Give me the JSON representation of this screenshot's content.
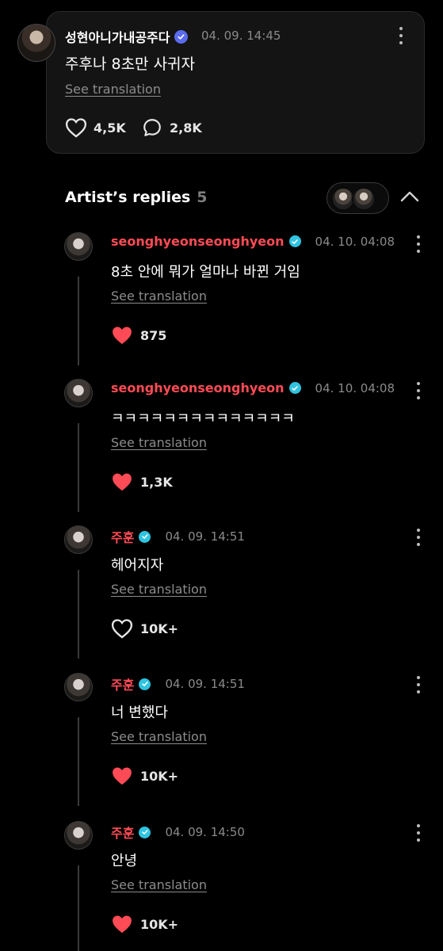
{
  "post": {
    "author": "성현아니가내공주다",
    "time": "04. 09. 14:45",
    "text": "주후나 8초만 사귀자",
    "see_translation": "See translation",
    "likes": "4,5K",
    "comments": "2,8K",
    "verify_icon": "verified-badge-icon",
    "accent": "#5b6cf0"
  },
  "replies_section": {
    "title": "Artist’s replies",
    "count": "5"
  },
  "replies": [
    {
      "name": "seonghyeonseonghyeon",
      "time": "04. 10. 04:08",
      "text": "8초 안에 뭐가 얼마나 바뀐 거임",
      "see_translation": "See translation",
      "likes": "875",
      "liked": true
    },
    {
      "name": "seonghyeonseonghyeon",
      "time": "04. 10. 04:08",
      "text": "ㅋㅋㅋㅋㅋㅋㅋㅋㅋㅋㅋㅋㅋㅋ",
      "see_translation": "See translation",
      "likes": "1,3K",
      "liked": true
    },
    {
      "name": "주훈",
      "time": "04. 09. 14:51",
      "text": "헤어지자",
      "see_translation": "See translation",
      "likes": "10K+",
      "liked": false
    },
    {
      "name": "주훈",
      "time": "04. 09. 14:51",
      "text": "너 변했다",
      "see_translation": "See translation",
      "likes": "10K+",
      "liked": true
    },
    {
      "name": "주훈",
      "time": "04. 09. 14:50",
      "text": "안녕",
      "see_translation": "See translation",
      "likes": "10K+",
      "liked": true
    }
  ],
  "colors": {
    "artist_name": "#ff4b55",
    "heart_filled": "#ff4b55",
    "verified_cyan": "#2fc4e0"
  }
}
